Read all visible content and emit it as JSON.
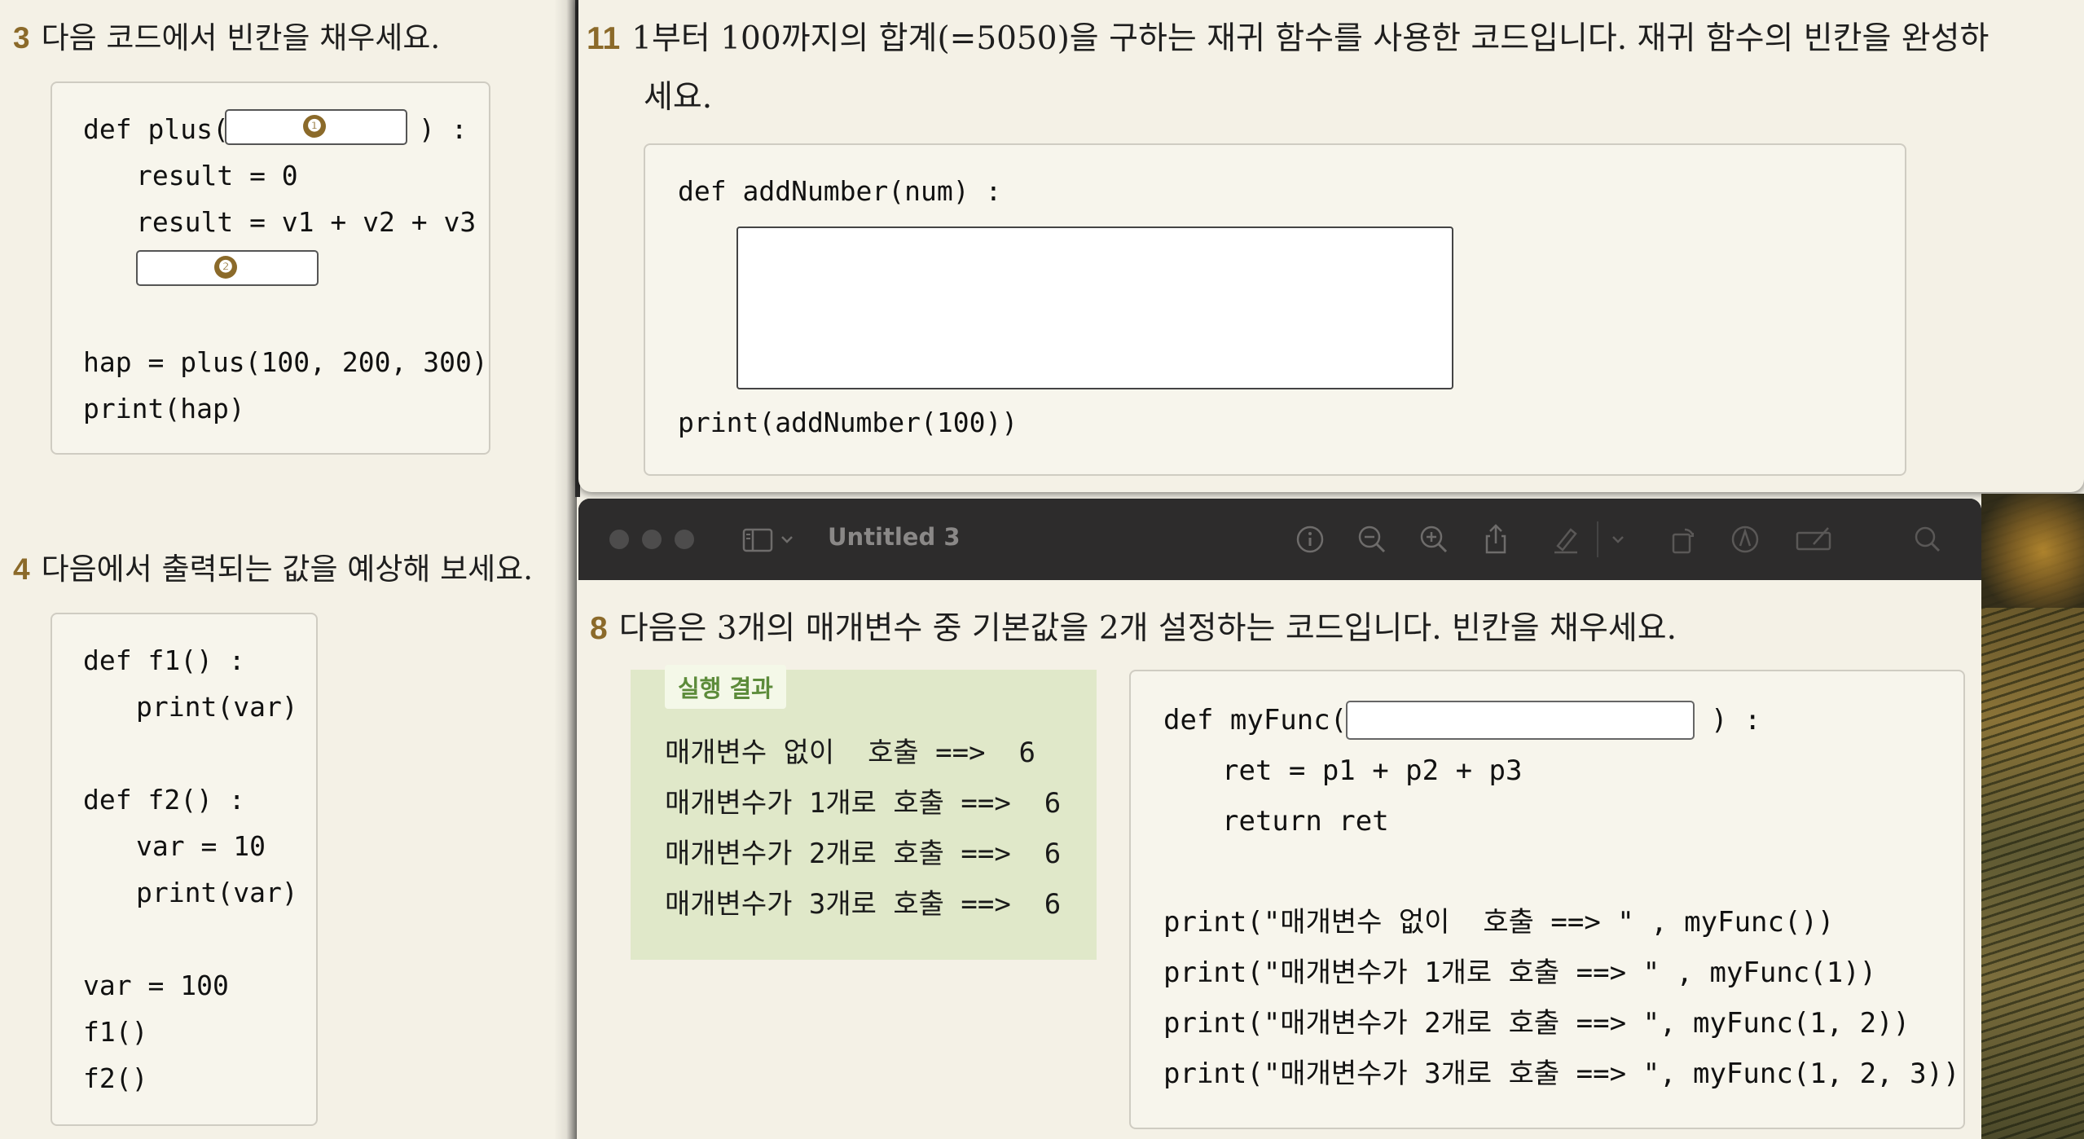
{
  "left_page": {
    "q3": {
      "num": "3",
      "title": "다음 코드에서 빈칸을 채우세요.",
      "code": {
        "def_line_start": "def plus(",
        "def_line_end": ") :",
        "blank1_marker": "❶",
        "line_result0": "result = 0",
        "line_result_sum": "result = v1 + v2 + v3",
        "blank2_marker": "❷",
        "line_hap": "hap = plus(100, 200, 300)",
        "line_print": "print(hap)"
      }
    },
    "q4": {
      "num": "4",
      "title": "다음에서 출력되는 값을 예상해 보세요.",
      "code": {
        "l1": "def f1() :",
        "l2": "print(var)",
        "l3": "def f2() :",
        "l4": "var = 10",
        "l5": "print(var)",
        "l6": "var = 100",
        "l7": "f1()",
        "l8": "f2()"
      }
    }
  },
  "top_window": {
    "q11": {
      "num": "11",
      "title_line1": "1부터 100까지의 합계(=5050)을 구하는 재귀 함수를 사용한 코드입니다. 재귀 함수의 빈칸을 완성하",
      "title_line2": "세요.",
      "code": {
        "def_line": "def addNumber(num) :",
        "print_line": "print(addNumber(100))"
      }
    }
  },
  "preview_window": {
    "title": "Untitled 3",
    "toolbar_icons": [
      "info-icon",
      "zoom-out-icon",
      "zoom-in-icon",
      "share-icon",
      "highlight-icon",
      "chevron-down-icon",
      "rotate-icon",
      "markup-icon",
      "annotate-icon",
      "search-icon"
    ],
    "q8": {
      "num": "8",
      "title": "다음은 3개의 매개변수 중 기본값을 2개 설정하는 코드입니다. 빈칸을 채우세요.",
      "result_label": "실행 결과",
      "results": [
        "매개변수 없이  호출 ==>  6",
        "매개변수가 1개로 호출 ==>  6",
        "매개변수가 2개로 호출 ==>  6",
        "매개변수가 3개로 호출 ==>  6"
      ],
      "code": {
        "def_start": "def myFunc(",
        "def_end": ") :",
        "ret_line": "ret = p1 + p2 + p3",
        "return_line": "return ret",
        "print_lines": [
          "print(\"매개변수 없이  호출 ==> \" , myFunc())",
          "print(\"매개변수가 1개로 호출 ==> \" , myFunc(1))",
          "print(\"매개변수가 2개로 호출 ==> \", myFunc(1, 2))",
          "print(\"매개변수가 3개로 호출 ==> \", myFunc(1, 2, 3))"
        ]
      }
    }
  },
  "colors": {
    "accent": "#8b6a2a",
    "page_bg": "#f4f1e6",
    "result_bg": "#e0e8c9",
    "result_label": "#5c8b3a",
    "toolbar_bg": "#2d2c2c"
  }
}
